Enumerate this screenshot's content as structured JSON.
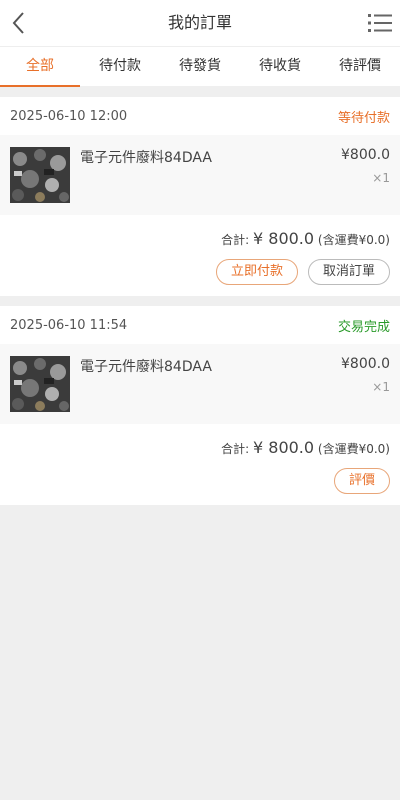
{
  "header": {
    "title": "我的訂單",
    "back_icon": "chevron-left-icon",
    "menu_icon": "list-menu-icon"
  },
  "tabs": [
    {
      "label": "全部",
      "active": true
    },
    {
      "label": "待付款",
      "active": false
    },
    {
      "label": "待發貨",
      "active": false
    },
    {
      "label": "待收貨",
      "active": false
    },
    {
      "label": "待評價",
      "active": false
    }
  ],
  "colors": {
    "accent": "#e8702a",
    "complete": "#2a9a2a",
    "background": "#efefef"
  },
  "orders": [
    {
      "date": "2025-06-10 12:00",
      "status": "等待付款",
      "status_color": "#e8702a",
      "product_name": "電子元件廢料84DAA",
      "price": "¥800.0",
      "qty": "×1",
      "total_label": "合計:",
      "total_amount": "¥ 800.0",
      "shipping_note": "(含運費¥0.0)",
      "actions": [
        "立即付款",
        "取消訂單"
      ]
    },
    {
      "date": "2025-06-10 11:54",
      "status": "交易完成",
      "status_color": "#2a9a2a",
      "product_name": "電子元件廢料84DAA",
      "price": "¥800.0",
      "qty": "×1",
      "total_label": "合計:",
      "total_amount": "¥ 800.0",
      "shipping_note": "(含運費¥0.0)",
      "actions": [
        "評價"
      ]
    }
  ]
}
